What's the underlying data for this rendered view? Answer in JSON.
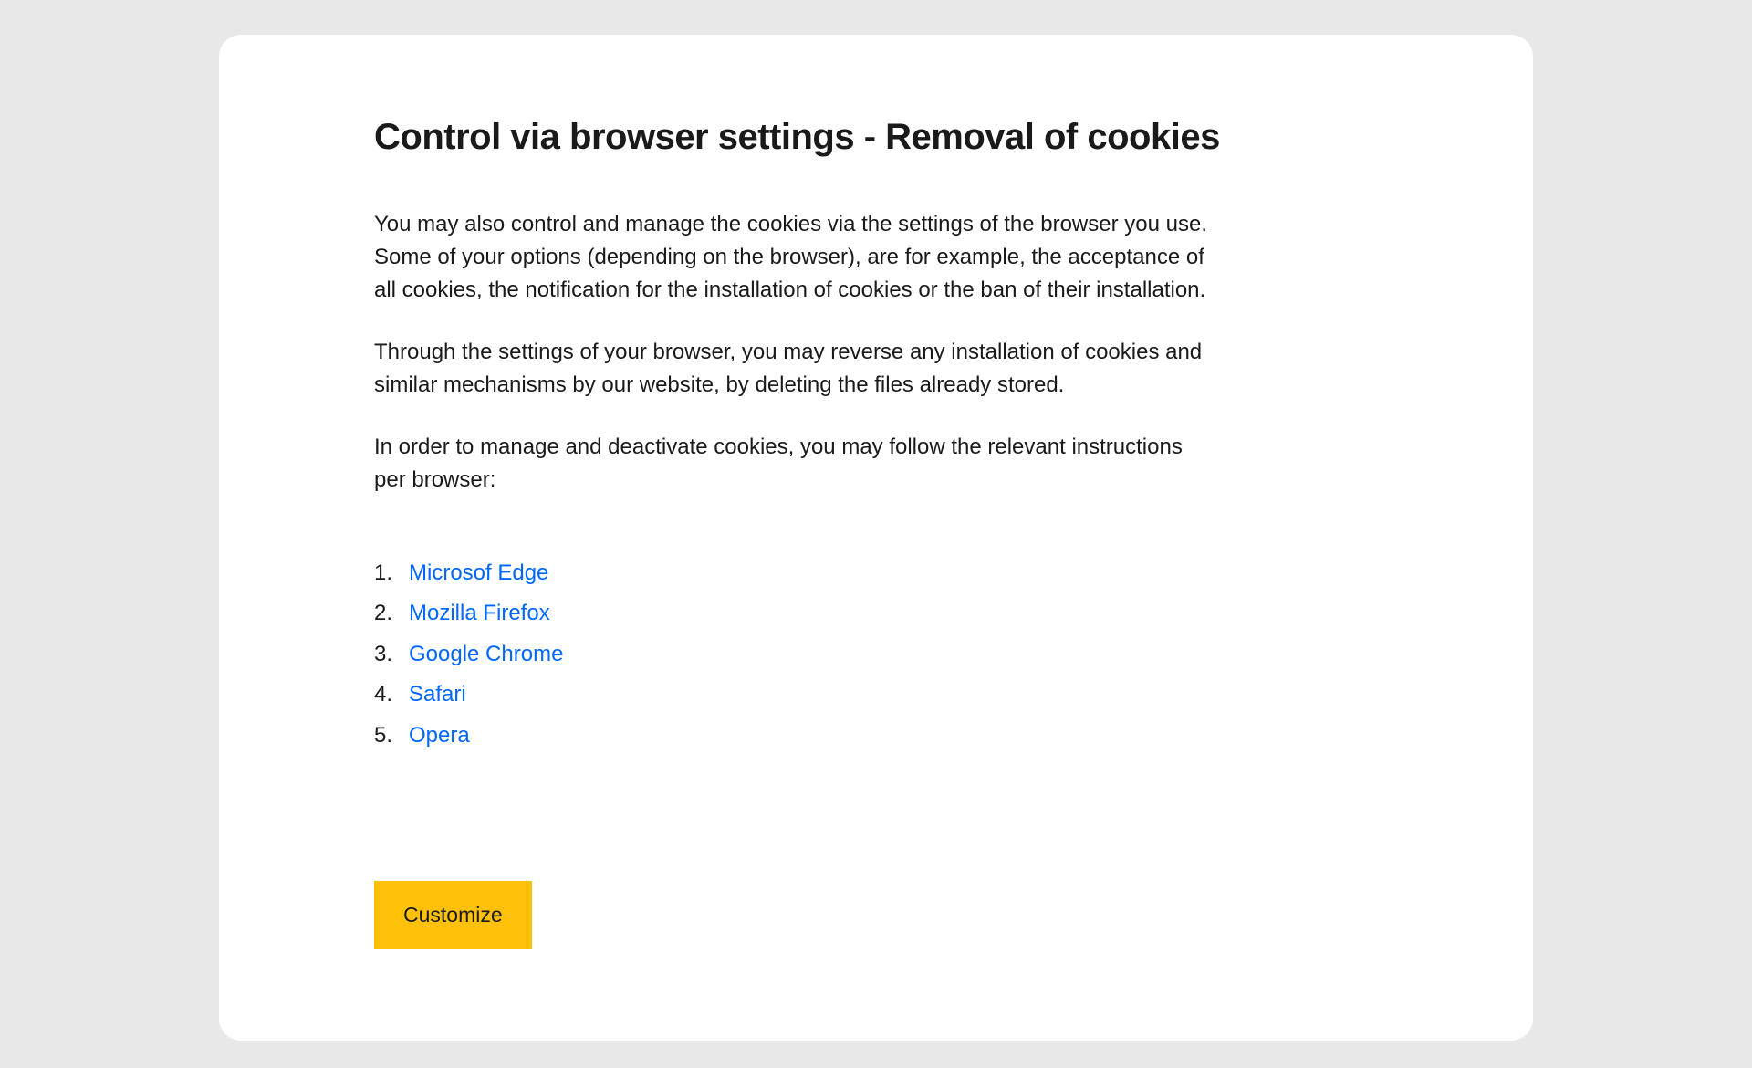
{
  "heading": "Control via browser settings - Removal of cookies",
  "paragraphs": {
    "p1": "You may also control and manage the cookies via the settings of the browser you use. Some of your options (depending on the browser), are for example, the acceptance of all cookies, the notification for the installation of cookies or the ban of their installation.",
    "p2": "Through the settings of your browser, you may reverse any installation of cookies and similar mechanisms by our website, by deleting the files already stored.",
    "p3": "In order to manage and deactivate cookies, you may follow the relevant instructions per browser:"
  },
  "browsers": [
    {
      "number": "1.",
      "name": "Microsof Edge"
    },
    {
      "number": "2.",
      "name": "Mozilla Firefox"
    },
    {
      "number": "3.",
      "name": "Google Chrome"
    },
    {
      "number": "4.",
      "name": "Safari"
    },
    {
      "number": "5.",
      "name": "Opera"
    }
  ],
  "button": {
    "customize_label": "Customize"
  }
}
